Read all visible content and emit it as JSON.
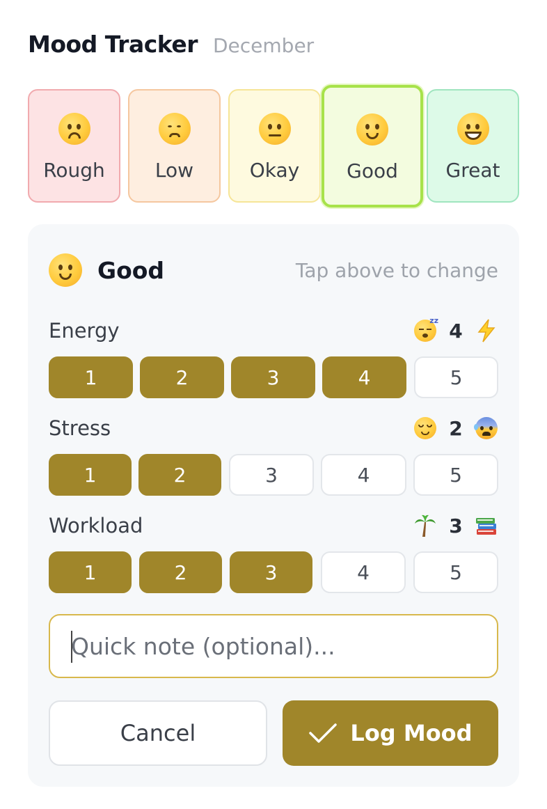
{
  "header": {
    "title": "Mood Tracker",
    "subtitle": "December"
  },
  "moods": [
    {
      "label": "Rough",
      "icon": "frowning-face-icon",
      "bg": "#fde3e4",
      "border": "#f1aaae",
      "selected": false
    },
    {
      "label": "Low",
      "icon": "pensive-face-icon",
      "bg": "#feeee0",
      "border": "#f5c79f",
      "selected": false
    },
    {
      "label": "Okay",
      "icon": "neutral-face-icon",
      "bg": "#fefadf",
      "border": "#f6e597",
      "selected": false
    },
    {
      "label": "Good",
      "icon": "slightly-smiling-face-icon",
      "bg": "#f3fcdf",
      "border": "#a7e24a",
      "selected": true
    },
    {
      "label": "Great",
      "icon": "grinning-face-icon",
      "bg": "#ddfae8",
      "border": "#9fe5bf",
      "selected": false
    }
  ],
  "selected": {
    "label": "Good",
    "hint": "Tap above to change",
    "icon": "slightly-smiling-face-icon"
  },
  "metrics": [
    {
      "name": "Energy",
      "value": "4",
      "low_icon": "sleepy-face-icon",
      "high_icon": "lightning-icon",
      "options": [
        "1",
        "2",
        "3",
        "4",
        "5"
      ]
    },
    {
      "name": "Stress",
      "value": "2",
      "low_icon": "relieved-face-icon",
      "high_icon": "anxious-face-icon",
      "options": [
        "1",
        "2",
        "3",
        "4",
        "5"
      ]
    },
    {
      "name": "Workload",
      "value": "3",
      "low_icon": "palm-tree-icon",
      "high_icon": "books-icon",
      "options": [
        "1",
        "2",
        "3",
        "4",
        "5"
      ]
    }
  ],
  "note": {
    "placeholder": "Quick note (optional)...",
    "value": ""
  },
  "actions": {
    "cancel": "Cancel",
    "log": "Log Mood"
  },
  "colors": {
    "accent": "#a0862a",
    "note_border": "#d8b84c",
    "panel": "#f6f8fa"
  }
}
